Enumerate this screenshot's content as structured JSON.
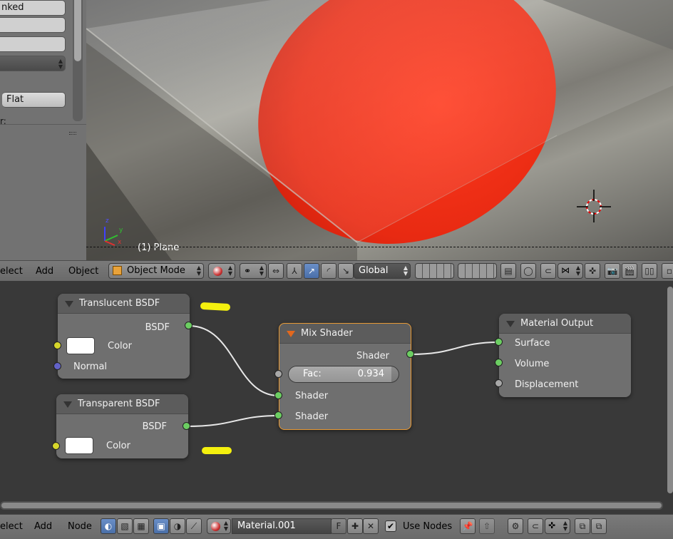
{
  "properties_panel": {
    "field_1": "nked",
    "field_2": "",
    "field_3": "",
    "field_4": "",
    "flat_button": "Flat",
    "partial_label": "r:"
  },
  "viewport": {
    "object_label": "(1) Plane",
    "axis_z": "z",
    "axis_y": "y",
    "axis_x": "x"
  },
  "header_3d": {
    "menu_select": "elect",
    "menu_add": "Add",
    "menu_object": "Object",
    "mode": "Object Mode",
    "orientation": "Global"
  },
  "nodes": {
    "translucent": {
      "title": "Translucent BSDF",
      "output": "BSDF",
      "input_color": "Color",
      "input_normal": "Normal"
    },
    "transparent": {
      "title": "Transparent BSDF",
      "output": "BSDF",
      "input_color": "Color"
    },
    "mix": {
      "title": "Mix Shader",
      "output": "Shader",
      "fac_label": "Fac:",
      "fac_value": "0.934",
      "fac_fraction": 0.934,
      "input_shader_1": "Shader",
      "input_shader_2": "Shader"
    },
    "output": {
      "title": "Material Output",
      "input_surface": "Surface",
      "input_volume": "Volume",
      "input_displacement": "Displacement"
    }
  },
  "header_node": {
    "menu_select": "elect",
    "menu_add": "Add",
    "menu_node": "Node",
    "material_name": "Material.001",
    "fake_user": "F",
    "use_nodes_label": "Use Nodes",
    "use_nodes_checked": true
  },
  "colors": {
    "socket_shader": "#6cce62",
    "socket_color": "#d6d62b",
    "socket_vector": "#6262c8",
    "socket_value": "#a8a8a8",
    "active_node_border": "#e89a35",
    "highlight_mark": "#f4f00e"
  }
}
